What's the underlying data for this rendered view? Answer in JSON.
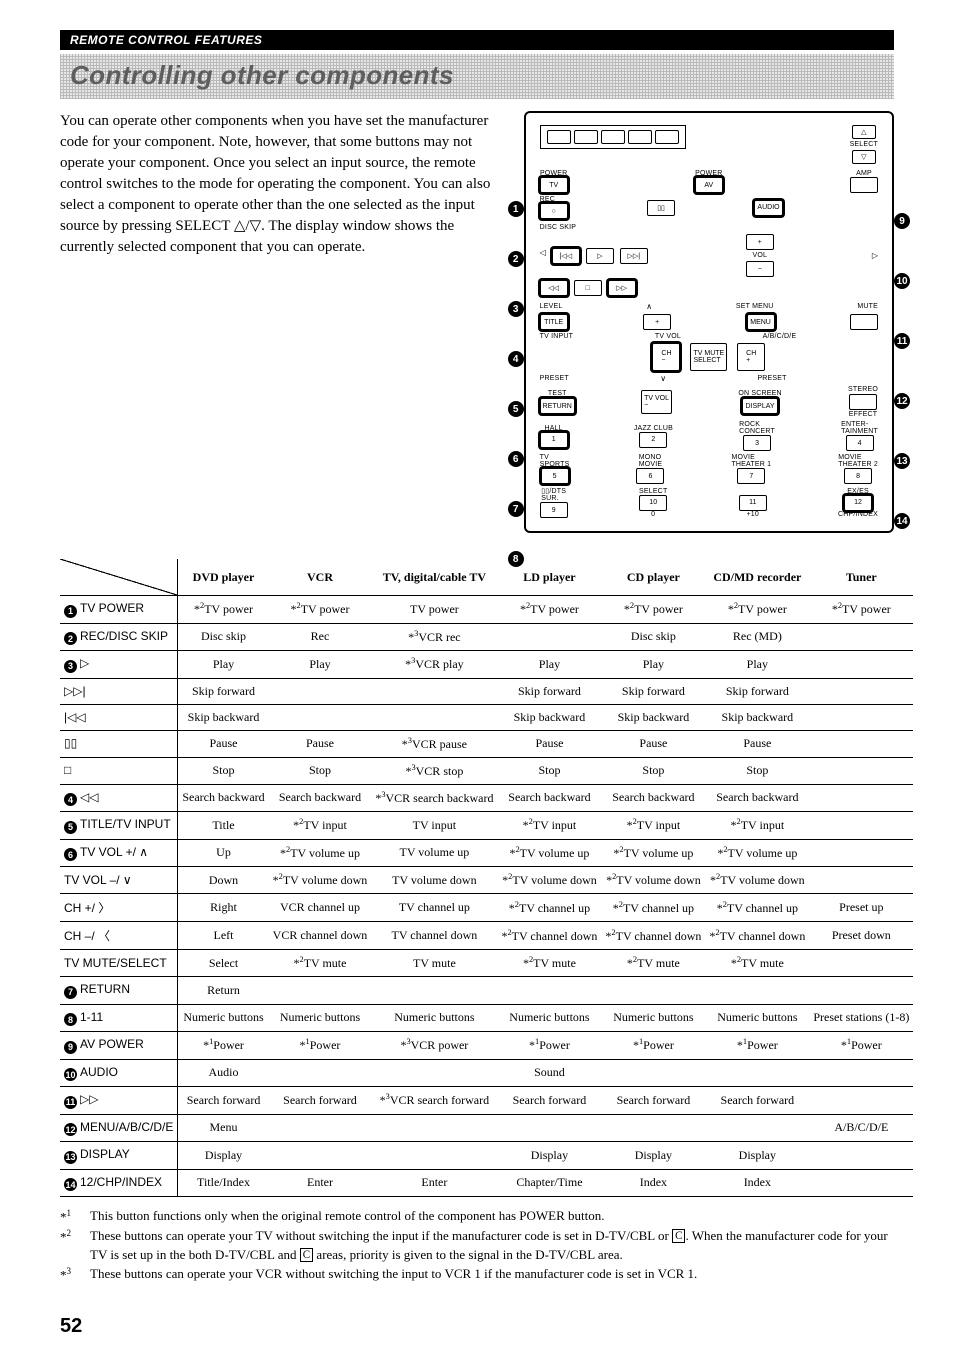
{
  "section_header": "REMOTE CONTROL FEATURES",
  "page_title": "Controlling other components",
  "intro": "You can operate other components when you have set the manufacturer code for your component. Note, however, that some buttons may not operate your component. Once you select an input source, the remote control switches to the mode for operating the component. You can also select a component to operate other than the one selected as the input source by pressing SELECT △/▽. The display window shows the currently selected component that you can operate.",
  "callouts_left": [
    "1",
    "2",
    "3",
    "4",
    "5",
    "6",
    "7",
    "8"
  ],
  "callouts_right": [
    "9",
    "10",
    "11",
    "12",
    "13",
    "14"
  ],
  "remote_labels": {
    "select": "SELECT",
    "power_l": "POWER",
    "power_r": "POWER",
    "amp": "AMP",
    "tv": "TV",
    "av": "AV",
    "rec": "REC",
    "audio": "AUDIO",
    "disc_skip": "DISC SKIP",
    "vol": "VOL",
    "level": "LEVEL",
    "set_menu": "SET MENU",
    "mute": "MUTE",
    "title": "TITLE",
    "menu": "MENU",
    "tv_input": "TV INPUT",
    "tv_vol": "TV VOL",
    "abcde": "A/B/C/D/E",
    "ch": "CH",
    "tvmute": "TV MUTE\\nSELECT",
    "preset_l": "PRESET",
    "preset_r": "PRESET",
    "test": "TEST",
    "onscreen": "ON SCREEN",
    "stereo": "STEREO",
    "return": "RETURN",
    "display": "DISPLAY",
    "effect": "EFFECT",
    "hall": "HALL",
    "jazz": "JAZZ CLUB",
    "rock": "ROCK\\nCONCERT",
    "enter": "ENTER-\\nTAINMENT",
    "tvsports": "TV\\nSPORTS",
    "mono": "MONO\\nMOVIE",
    "mt1": "MOVIE\\nTHEATER 1",
    "mt2": "MOVIE\\nTHEATER 2",
    "dts": "▯▯/DTS\\nSUR.",
    "sel": "SELECT",
    "exes": "EX/ES",
    "n0": "0",
    "n10": "+10",
    "chp": "CHP/INDEX"
  },
  "table": {
    "columns": [
      "DVD player",
      "VCR",
      "TV, digital/cable TV",
      "LD player",
      "CD player",
      "CD/MD recorder",
      "Tuner"
    ],
    "rows": [
      {
        "bullet": "1",
        "label": "TV POWER",
        "cells": [
          "*²TV power",
          "*²TV power",
          "TV power",
          "*²TV power",
          "*²TV power",
          "*²TV power",
          "*²TV power"
        ]
      },
      {
        "bullet": "2",
        "label": "REC/DISC SKIP",
        "cells": [
          "Disc skip",
          "Rec",
          "*³VCR rec",
          "",
          "Disc skip",
          "Rec (MD)",
          ""
        ]
      },
      {
        "bullet": "3",
        "label": "▷",
        "cells": [
          "Play",
          "Play",
          "*³VCR play",
          "Play",
          "Play",
          "Play",
          ""
        ]
      },
      {
        "bullet": "",
        "label": "▷▷|",
        "cells": [
          "Skip forward",
          "",
          "",
          "Skip forward",
          "Skip forward",
          "Skip forward",
          ""
        ]
      },
      {
        "bullet": "",
        "label": "|◁◁",
        "cells": [
          "Skip backward",
          "",
          "",
          "Skip backward",
          "Skip backward",
          "Skip backward",
          ""
        ]
      },
      {
        "bullet": "",
        "label": "▯▯",
        "cells": [
          "Pause",
          "Pause",
          "*³VCR pause",
          "Pause",
          "Pause",
          "Pause",
          ""
        ]
      },
      {
        "bullet": "",
        "label": "□",
        "cells": [
          "Stop",
          "Stop",
          "*³VCR stop",
          "Stop",
          "Stop",
          "Stop",
          ""
        ]
      },
      {
        "bullet": "4",
        "label": "◁◁",
        "cells": [
          "Search backward",
          "Search backward",
          "*³VCR search backward",
          "Search backward",
          "Search backward",
          "Search backward",
          ""
        ]
      },
      {
        "bullet": "5",
        "label": "TITLE/TV INPUT",
        "cells": [
          "Title",
          "*²TV input",
          "TV input",
          "*²TV input",
          "*²TV input",
          "*²TV input",
          ""
        ]
      },
      {
        "bullet": "6",
        "label": "TV VOL +/ ∧",
        "cells": [
          "Up",
          "*²TV volume up",
          "TV volume up",
          "*²TV volume up",
          "*²TV volume up",
          "*²TV volume up",
          ""
        ]
      },
      {
        "bullet": "",
        "label": "TV VOL –/ ∨",
        "cells": [
          "Down",
          "*²TV volume down",
          "TV volume down",
          "*²TV volume down",
          "*²TV volume down",
          "*²TV volume down",
          ""
        ]
      },
      {
        "bullet": "",
        "label": "CH +/ 〉",
        "cells": [
          "Right",
          "VCR channel up",
          "TV channel up",
          "*²TV channel up",
          "*²TV channel up",
          "*²TV channel up",
          "Preset up"
        ]
      },
      {
        "bullet": "",
        "label": "CH –/ 〈",
        "cells": [
          "Left",
          "VCR channel down",
          "TV channel down",
          "*²TV channel down",
          "*²TV channel down",
          "*²TV channel down",
          "Preset down"
        ]
      },
      {
        "bullet": "",
        "label": "TV MUTE/SELECT",
        "cells": [
          "Select",
          "*²TV mute",
          "TV mute",
          "*²TV mute",
          "*²TV mute",
          "*²TV mute",
          ""
        ]
      },
      {
        "bullet": "7",
        "label": "RETURN",
        "cells": [
          "Return",
          "",
          "",
          "",
          "",
          "",
          ""
        ]
      },
      {
        "bullet": "8",
        "label": "1-11",
        "cells": [
          "Numeric buttons",
          "Numeric buttons",
          "Numeric buttons",
          "Numeric buttons",
          "Numeric buttons",
          "Numeric buttons",
          "Preset stations (1-8)"
        ]
      },
      {
        "bullet": "9",
        "label": "AV POWER",
        "cells": [
          "*¹Power",
          "*¹Power",
          "*³VCR power",
          "*¹Power",
          "*¹Power",
          "*¹Power",
          "*¹Power"
        ]
      },
      {
        "bullet": "10",
        "label": "AUDIO",
        "cells": [
          "Audio",
          "",
          "",
          "Sound",
          "",
          "",
          ""
        ]
      },
      {
        "bullet": "11",
        "label": "▷▷",
        "cells": [
          "Search forward",
          "Search forward",
          "*³VCR search forward",
          "Search forward",
          "Search forward",
          "Search forward",
          ""
        ]
      },
      {
        "bullet": "12",
        "label": "MENU/A/B/C/D/E",
        "cells": [
          "Menu",
          "",
          "",
          "",
          "",
          "",
          "A/B/C/D/E"
        ]
      },
      {
        "bullet": "13",
        "label": "DISPLAY",
        "cells": [
          "Display",
          "",
          "",
          "Display",
          "Display",
          "Display",
          ""
        ]
      },
      {
        "bullet": "14",
        "label": "12/CHP/INDEX",
        "cells": [
          "Title/Index",
          "Enter",
          "Enter",
          "Chapter/Time",
          "Index",
          "Index",
          ""
        ]
      }
    ]
  },
  "footnotes": [
    {
      "tag": "*¹",
      "text": "This button functions only when the original remote control of the component has POWER button."
    },
    {
      "tag": "*²",
      "text": "These buttons can operate your TV without switching the input if the manufacturer code is set in D-TV/CBL or [C]. When the manufacturer code for your TV is set up in the both D-TV/CBL and [C] areas, priority is given to the signal in the D-TV/CBL area."
    },
    {
      "tag": "*³",
      "text": "These buttons can operate your VCR without switching the input to VCR 1 if the manufacturer code is set in VCR 1."
    }
  ],
  "page_number": "52"
}
